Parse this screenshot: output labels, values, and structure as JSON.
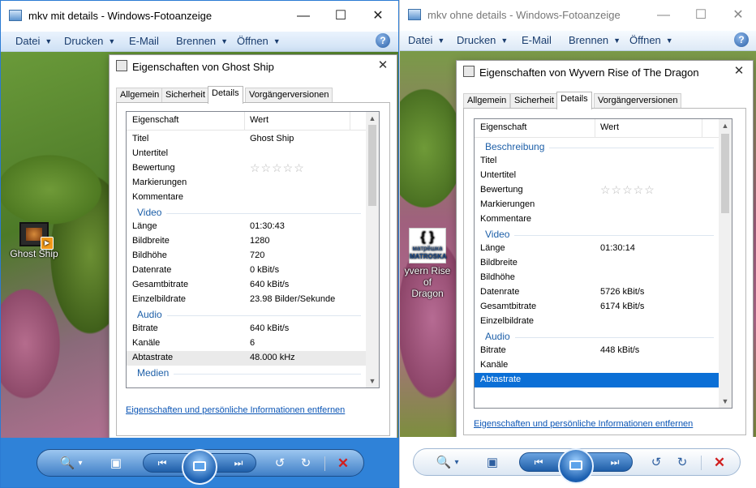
{
  "left_window": {
    "title": "mkv mit details - Windows-Fotoanzeige",
    "controls": {
      "minimize": "—",
      "maximize": "☐",
      "close": "✕"
    },
    "menu": [
      {
        "label": "Datei",
        "dropdown": true
      },
      {
        "label": "Drucken",
        "dropdown": true
      },
      {
        "label": "E-Mail",
        "dropdown": false
      },
      {
        "label": "Brennen",
        "dropdown": true
      },
      {
        "label": "Öffnen",
        "dropdown": true
      }
    ],
    "help": "?",
    "desktop_icon": {
      "label": "Ghost Ship"
    },
    "dialog": {
      "title": "Eigenschaften von Ghost Ship",
      "tabs": [
        "Allgemein",
        "Sicherheit",
        "Details",
        "Vorgängerversionen"
      ],
      "active_tab": "Details",
      "columns": {
        "property": "Eigenschaft",
        "value": "Wert"
      },
      "rows": [
        {
          "type": "row",
          "key": "Titel",
          "value": "Ghost Ship"
        },
        {
          "type": "row",
          "key": "Untertitel",
          "value": ""
        },
        {
          "type": "row",
          "key": "Bewertung",
          "value": "☆☆☆☆☆",
          "stars": true
        },
        {
          "type": "row",
          "key": "Markierungen",
          "value": ""
        },
        {
          "type": "row",
          "key": "Kommentare",
          "value": ""
        },
        {
          "type": "group",
          "label": "Video"
        },
        {
          "type": "row",
          "key": "Länge",
          "value": "01:30:43"
        },
        {
          "type": "row",
          "key": "Bildbreite",
          "value": "1280"
        },
        {
          "type": "row",
          "key": "Bildhöhe",
          "value": "720"
        },
        {
          "type": "row",
          "key": "Datenrate",
          "value": "0 kBit/s"
        },
        {
          "type": "row",
          "key": "Gesamtbitrate",
          "value": "640 kBit/s"
        },
        {
          "type": "row",
          "key": "Einzelbildrate",
          "value": "23.98 Bilder/Sekunde"
        },
        {
          "type": "group",
          "label": "Audio"
        },
        {
          "type": "row",
          "key": "Bitrate",
          "value": "640 kBit/s"
        },
        {
          "type": "row",
          "key": "Kanäle",
          "value": "6"
        },
        {
          "type": "row",
          "key": "Abtastrate",
          "value": "48.000 kHz",
          "state": "hover"
        },
        {
          "type": "group",
          "label": "Medien"
        }
      ],
      "remove_link": "Eigenschaften und persönliche Informationen entfernen"
    }
  },
  "right_window": {
    "title": "mkv ohne details - Windows-Fotoanzeige",
    "controls": {
      "minimize": "—",
      "maximize": "☐",
      "close": "✕"
    },
    "menu": [
      {
        "label": "Datei",
        "dropdown": true
      },
      {
        "label": "Drucken",
        "dropdown": true
      },
      {
        "label": "E-Mail",
        "dropdown": false
      },
      {
        "label": "Brennen",
        "dropdown": true
      },
      {
        "label": "Öffnen",
        "dropdown": true
      }
    ],
    "help": "?",
    "desktop_icon": {
      "label_line1": "yvern Rise of",
      "label_line2": "Dragon",
      "logo_text": "матрёшка",
      "logo_sub": "MATROSKA"
    },
    "dialog": {
      "title": "Eigenschaften von Wyvern Rise of The Dragon",
      "tabs": [
        "Allgemein",
        "Sicherheit",
        "Details",
        "Vorgängerversionen"
      ],
      "active_tab": "Details",
      "columns": {
        "property": "Eigenschaft",
        "value": "Wert"
      },
      "rows": [
        {
          "type": "group",
          "label": "Beschreibung"
        },
        {
          "type": "row",
          "key": "Titel",
          "value": ""
        },
        {
          "type": "row",
          "key": "Untertitel",
          "value": ""
        },
        {
          "type": "row",
          "key": "Bewertung",
          "value": "☆☆☆☆☆",
          "stars": true
        },
        {
          "type": "row",
          "key": "Markierungen",
          "value": ""
        },
        {
          "type": "row",
          "key": "Kommentare",
          "value": ""
        },
        {
          "type": "group",
          "label": "Video"
        },
        {
          "type": "row",
          "key": "Länge",
          "value": "01:30:14"
        },
        {
          "type": "row",
          "key": "Bildbreite",
          "value": ""
        },
        {
          "type": "row",
          "key": "Bildhöhe",
          "value": ""
        },
        {
          "type": "row",
          "key": "Datenrate",
          "value": "5726 kBit/s"
        },
        {
          "type": "row",
          "key": "Gesamtbitrate",
          "value": "6174 kBit/s"
        },
        {
          "type": "row",
          "key": "Einzelbildrate",
          "value": ""
        },
        {
          "type": "group",
          "label": "Audio"
        },
        {
          "type": "row",
          "key": "Bitrate",
          "value": "448 kBit/s"
        },
        {
          "type": "row",
          "key": "Kanäle",
          "value": ""
        },
        {
          "type": "row",
          "key": "Abtastrate",
          "value": "",
          "state": "selected"
        }
      ],
      "remove_link": "Eigenschaften und persönliche Informationen entfernen"
    }
  },
  "toolbar": {
    "zoom": "🔍",
    "zoom_dropdown": "▾",
    "fit": "▣",
    "prev": "⏮",
    "next": "⏭",
    "rotate_ccw": "↺",
    "rotate_cw": "↻",
    "delete": "✕"
  },
  "colors": {
    "accent": "#2f82d8",
    "selection": "#0b6fd6",
    "group_heading": "#1d5fa8",
    "link": "#0b55b5",
    "delete": "#d12020"
  }
}
